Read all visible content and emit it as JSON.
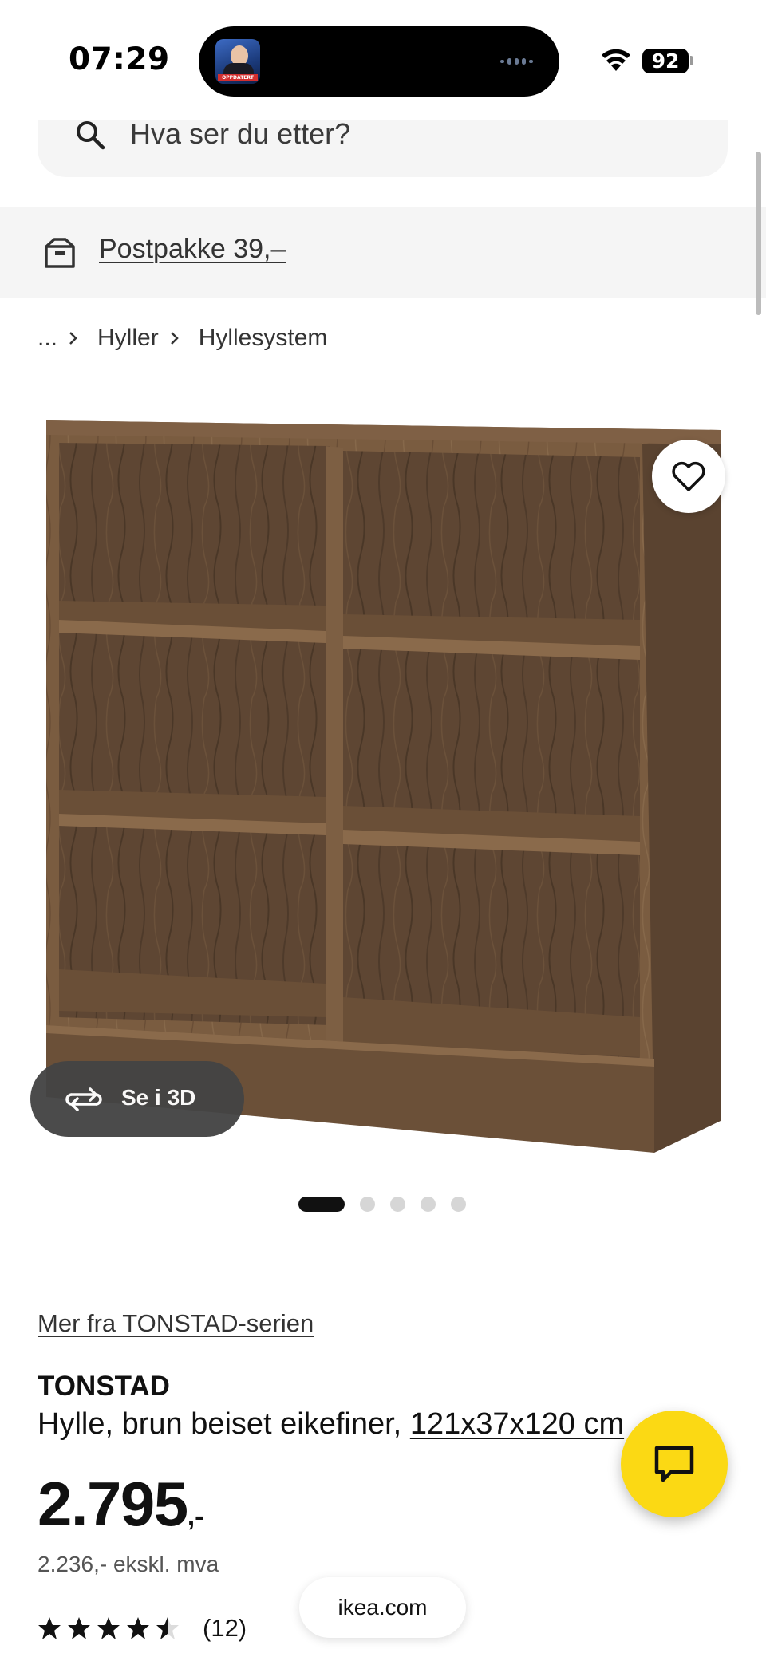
{
  "status_bar": {
    "time": "07:29",
    "battery": "92",
    "island_thumbnail_label": "OPPDATERT"
  },
  "search": {
    "placeholder": "Hva ser du etter?",
    "icon": "search-icon"
  },
  "delivery_banner": {
    "label": "Postpakke 39,–",
    "icon": "box-icon"
  },
  "breadcrumb": {
    "ellipsis": "...",
    "items": [
      "Hyller",
      "Hyllesystem"
    ]
  },
  "gallery": {
    "view_3d_label": "Se i 3D",
    "slide_count": 5,
    "active_slide": 1
  },
  "product": {
    "series_link": "Mer fra TONSTAD-serien",
    "name": "TONSTAD",
    "description": "Hylle, brun beiset eikefiner,",
    "dimensions": "121x37x120 cm",
    "price": "2.795",
    "price_suffix": ",-",
    "price_ex_vat": "2.236,- ekskl. mva",
    "rating": 4.5,
    "rating_count": "(12)"
  },
  "browser": {
    "url": "ikea.com"
  },
  "colors": {
    "accent_yellow": "#fbd914",
    "panel_gray": "#f5f5f5",
    "wood_brown": "#6b4f35"
  }
}
